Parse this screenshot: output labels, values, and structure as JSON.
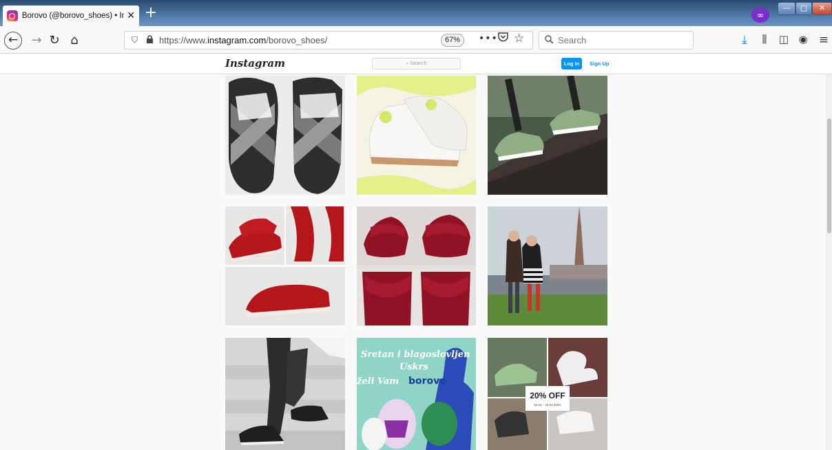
{
  "browser": {
    "tab_title": "Borovo (@borovo_shoes) • Inst",
    "tab_close": "✕",
    "new_tab": "+",
    "url_prefix": "https://www.",
    "url_domain": "instagram.com",
    "url_path": "/borovo_shoes/",
    "zoom": "67%",
    "search_placeholder": "Search",
    "colors": {
      "accent": "#0a84ff",
      "titlebar": "#4f7aa8",
      "private": "#7b2ec8"
    }
  },
  "instagram": {
    "logo": "Instagram",
    "search_placeholder": "Search",
    "login_label": "Log In",
    "signup_label": "Sign Up",
    "colors": {
      "primary": "#0095f6"
    }
  },
  "posts": [
    {
      "id": "post-1",
      "subject": "grey-white-cross-strap-loafers"
    },
    {
      "id": "post-2",
      "subject": "white-sneakers-yellow-background"
    },
    {
      "id": "post-3",
      "subject": "camo-sneakers-on-tree"
    },
    {
      "id": "post-4",
      "subject": "red-leather-ballerinas-collage"
    },
    {
      "id": "post-5",
      "subject": "burgundy-ruffle-flats"
    },
    {
      "id": "post-6",
      "subject": "two-women-in-field-cathedral"
    },
    {
      "id": "post-7",
      "subject": "black-sneakers-on-stairs"
    },
    {
      "id": "post-8",
      "subject": "easter-greeting",
      "text_line1": "Sretan i blagoslovljen",
      "text_line2": "Uskrs",
      "text_line3": "želi Vam",
      "brand": "borovo"
    },
    {
      "id": "post-9",
      "subject": "sneakers-collage-sale",
      "badge": "20% OFF",
      "badge_sub": "15.04. - 19.04.2020."
    }
  ]
}
